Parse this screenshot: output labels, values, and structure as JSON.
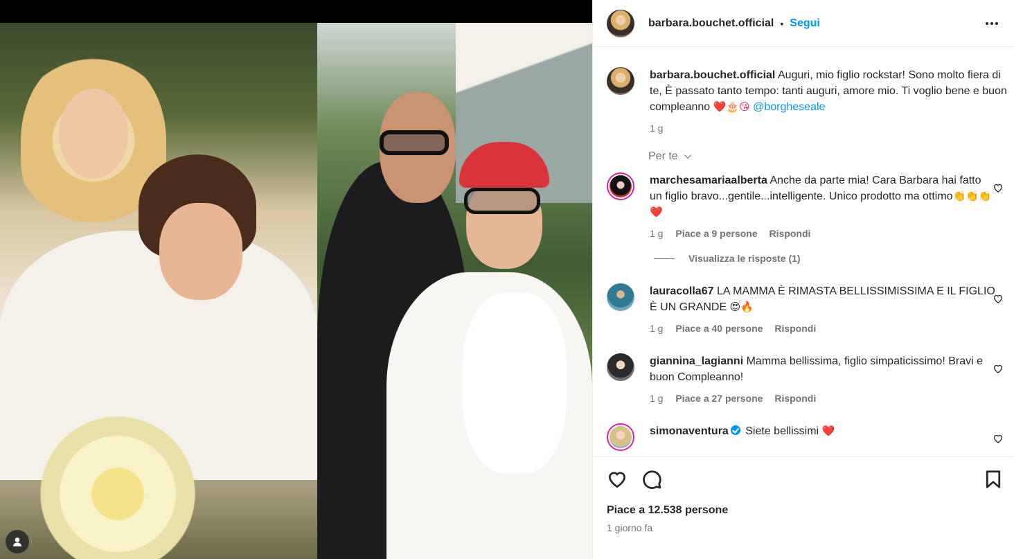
{
  "post": {
    "username": "barbara.bouchet.official",
    "follow_label": "Segui",
    "separator": "•"
  },
  "caption": {
    "username": "barbara.bouchet.official",
    "text": " Auguri, mio figlio rockstar! Sono molto fiera di te, È passato tanto tempo: tanti auguri, amore mio. Ti voglio bene e buon compleanno ",
    "emojis": "❤️🎂😘",
    "mention": "@borgheseale",
    "time": "1 g"
  },
  "for_you_label": "Per te",
  "comments": [
    {
      "username": "marchesamariaalberta",
      "text": " Anche da parte mia! Cara Barbara hai fatto un figlio bravo...gentile...intelligente. Unico prodotto ma ottimo",
      "emojis": "👏👏👏❤️",
      "time": "1 g",
      "likes": "Piace a 9 persone",
      "reply": "Rispondi",
      "view_replies": "Visualizza le risposte (1)"
    },
    {
      "username": "lauracolla67",
      "text": " LA MAMMA È RIMASTA BELLISSIMISSIMA E IL FIGLIO È UN GRANDE ",
      "emojis": "😍🔥",
      "time": "1 g",
      "likes": "Piace a 40 persone",
      "reply": "Rispondi"
    },
    {
      "username": "giannina_lagianni",
      "text": " Mamma bellissima, figlio simpaticissimo! Bravi e buon Compleanno!",
      "time": "1 g",
      "likes": "Piace a 27 persone",
      "reply": "Rispondi"
    },
    {
      "username": "simonaventura",
      "text": " Siete bellissimi ",
      "emojis": "❤️"
    }
  ],
  "footer": {
    "likes": "Piace a 12.538 persone",
    "time_ago": "1 giorno fa"
  },
  "colors": {
    "accent": "#0095f6",
    "text": "#262626",
    "muted": "#737373"
  },
  "icons": {
    "like": "heart-icon",
    "comment": "comment-icon",
    "save": "bookmark-icon",
    "more": "more-horizontal-icon",
    "tag": "user-tag-icon"
  }
}
